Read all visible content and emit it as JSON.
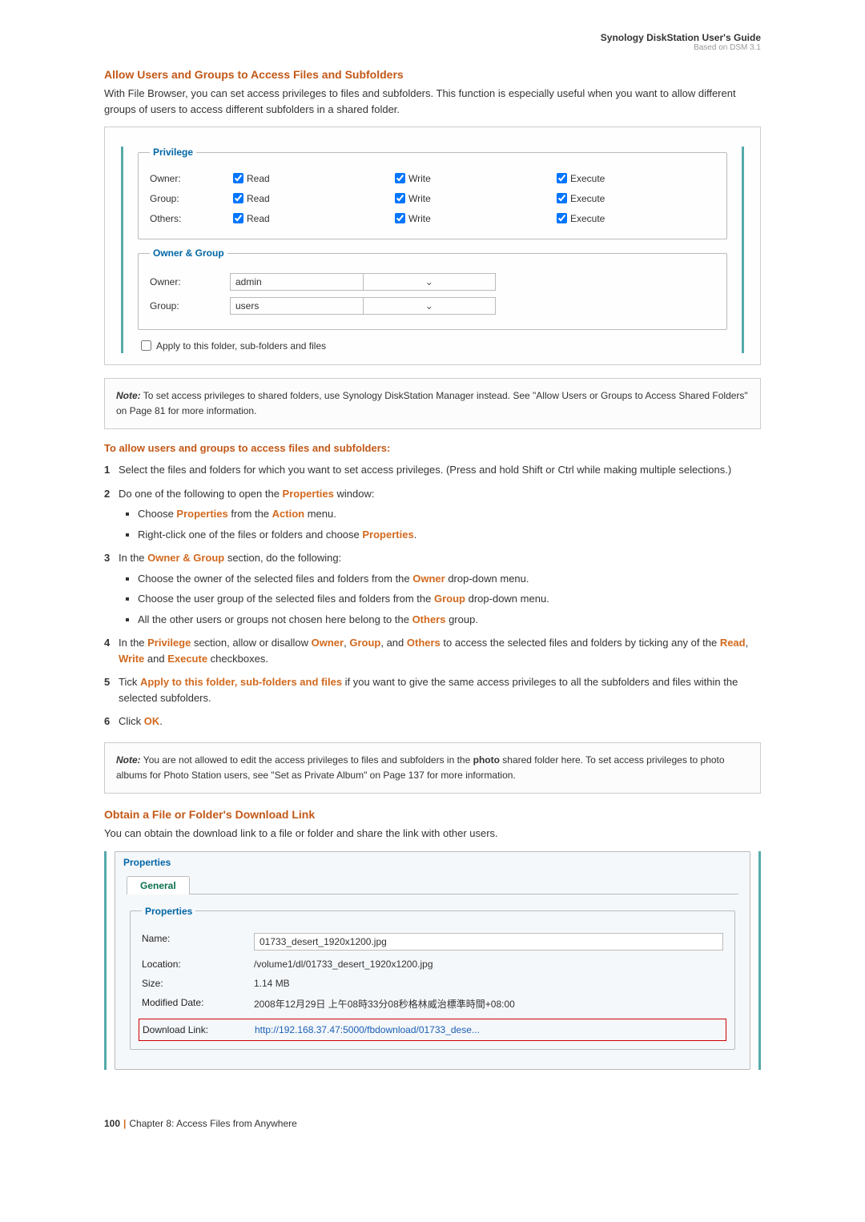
{
  "header": {
    "title": "Synology DiskStation User's Guide",
    "subtitle": "Based on DSM 3.1"
  },
  "section1": {
    "title": "Allow Users and Groups to Access Files and Subfolders",
    "intro": "With File Browser, you can set access privileges to files and subfolders. This function is especially useful when you want to allow different groups of users to access different subfolders in a shared folder."
  },
  "privilege": {
    "legend": "Privilege",
    "rows": [
      "Owner:",
      "Group:",
      "Others:"
    ],
    "perms": [
      "Read",
      "Write",
      "Execute"
    ]
  },
  "ownergroup": {
    "legend": "Owner & Group",
    "owner_label": "Owner:",
    "owner_value": "admin",
    "group_label": "Group:",
    "group_value": "users"
  },
  "apply_label": "Apply to this folder, sub-folders and files",
  "note1": {
    "prefix": "Note:",
    "text": " To set access privileges to shared folders, use Synology DiskStation Manager instead. See \"Allow Users or Groups to Access Shared Folders\" on Page 81 for more information."
  },
  "subhead": "To allow users and groups to access files and subfolders:",
  "steps": {
    "s1": "Select the files and folders for which you want to set access privileges. (Press and hold Shift or Ctrl while making multiple selections.)",
    "s2": "Do one of the following to open the ",
    "s2b": " window:",
    "s2_b1a": "Choose ",
    "s2_b1b": " from the ",
    "s2_b1c": " menu.",
    "s2_b2a": "Right-click one of the files or folders and choose ",
    "s2_b2b": ".",
    "s3a": "In the ",
    "s3b": " section, do the following:",
    "s3_b1a": "Choose the owner of the selected files and folders from the ",
    "s3_b1b": " drop-down menu.",
    "s3_b2a": "Choose the user group of the selected files and folders from the ",
    "s3_b2b": " drop-down menu.",
    "s3_b3a": "All the other users or groups not chosen here belong to the ",
    "s3_b3b": " group.",
    "s4a": "In the ",
    "s4b": " section, allow or disallow ",
    "s4c": ", ",
    "s4d": ", and ",
    "s4e": " to access the selected files and folders by ticking any of the ",
    "s4f": ", ",
    "s4g": " and ",
    "s4h": " checkboxes.",
    "s5a": "Tick ",
    "s5b": " if you want to give the same access privileges to all the subfolders and files within the selected subfolders.",
    "s6a": "Click ",
    "s6b": "."
  },
  "terms": {
    "properties": "Properties",
    "action": "Action",
    "ownergroup": "Owner & Group",
    "owner": "Owner",
    "group": "Group",
    "others": "Others",
    "privilege": "Privilege",
    "read": "Read",
    "write": "Write",
    "execute": "Execute",
    "apply": "Apply to this folder, sub-folders and files",
    "ok": "OK"
  },
  "note2": {
    "prefix": "Note:",
    "text": " You are not allowed to edit the access privileges to files and subfolders in the ",
    "bold": "photo",
    "text2": " shared folder here. To set access privileges to photo albums for Photo Station users, see \"Set as Private Album\" on Page 137 for more information."
  },
  "section2": {
    "title": "Obtain a File or Folder's Download Link",
    "intro": "You can obtain the download link to a file or folder and share the link with other users."
  },
  "dialog": {
    "title": "Properties",
    "tab": "General",
    "legend": "Properties",
    "name_label": "Name:",
    "name_value": "01733_desert_1920x1200.jpg",
    "loc_label": "Location:",
    "loc_value": "/volume1/dl/01733_desert_1920x1200.jpg",
    "size_label": "Size:",
    "size_value": "1.14 MB",
    "mod_label": "Modified Date:",
    "mod_value": "2008年12月29日 上午08時33分08秒格林威治標準時間+08:00",
    "dl_label": "Download Link:",
    "dl_value": "http://192.168.37.47:5000/fbdownload/01733_dese..."
  },
  "footer": {
    "page": "100",
    "chapter": "Chapter 8: Access Files from Anywhere"
  }
}
